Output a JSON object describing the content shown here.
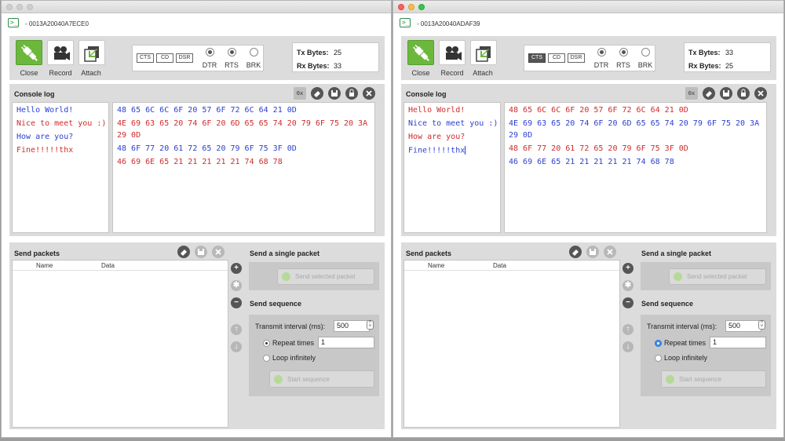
{
  "windows": [
    {
      "mac": "- 0013A20040A7ECE0",
      "toolbar": {
        "close": "Close",
        "record": "Record",
        "attach": "Attach"
      },
      "lines": {
        "cts": "CTS",
        "cd": "CD",
        "dsr": "DSR",
        "dtr": "DTR",
        "rts": "RTS",
        "brk": "BRK"
      },
      "bytes": {
        "tx_label": "Tx Bytes:",
        "tx_value": "25",
        "rx_label": "Rx Bytes:",
        "rx_value": "33"
      },
      "console": {
        "title": "Console log",
        "hex_button": "0x",
        "text_lines": [
          "Hello World!",
          "Nice to meet you :)",
          "How are you?",
          "Fine!!!!!thx"
        ],
        "hex_lines": [
          "48 65 6C 6C 6F 20 57 6F 72 6C 64 21 0D",
          "4E 69 63 65 20 74 6F 20 6D 65 65 74 20 79 6F 75 20 3A",
          "29 0D",
          "48 6F 77 20 61 72 65 20 79 6F 75 3F 0D",
          "46 69 6E 65 21 21 21 21 21 74 68 78"
        ]
      },
      "send": {
        "title": "Send packets",
        "col_name": "Name",
        "col_data": "Data",
        "single_title": "Send a single packet",
        "send_selected": "Send selected packet",
        "seq_title": "Send sequence",
        "interval_label": "Transmit interval (ms):",
        "interval_value": "500",
        "repeat_label": "Repeat times",
        "repeat_value": "1",
        "loop_label": "Loop infinitely",
        "start_label": "Start sequence"
      }
    },
    {
      "mac": "- 0013A20040ADAF39",
      "toolbar": {
        "close": "Close",
        "record": "Record",
        "attach": "Attach"
      },
      "lines": {
        "cts": "CTS",
        "cd": "CD",
        "dsr": "DSR",
        "dtr": "DTR",
        "rts": "RTS",
        "brk": "BRK"
      },
      "bytes": {
        "tx_label": "Tx Bytes:",
        "tx_value": "33",
        "rx_label": "Rx Bytes:",
        "rx_value": "25"
      },
      "console": {
        "title": "Console log",
        "hex_button": "0x",
        "text_lines": [
          "Hello World!",
          "Nice to meet you :)",
          "How are you?",
          "Fine!!!!!thx"
        ],
        "hex_lines": [
          "48 65 6C 6C 6F 20 57 6F 72 6C 64 21 0D",
          "4E 69 63 65 20 74 6F 20 6D 65 65 74 20 79 6F 75 20 3A",
          "29 0D",
          "48 6F 77 20 61 72 65 20 79 6F 75 3F 0D",
          "46 69 6E 65 21 21 21 21 21 74 68 78"
        ]
      },
      "send": {
        "title": "Send packets",
        "col_name": "Name",
        "col_data": "Data",
        "single_title": "Send a single packet",
        "send_selected": "Send selected packet",
        "seq_title": "Send sequence",
        "interval_label": "Transmit interval (ms):",
        "interval_value": "500",
        "repeat_label": "Repeat times",
        "repeat_value": "1",
        "loop_label": "Loop infinitely",
        "start_label": "Start sequence"
      }
    }
  ],
  "colors": {
    "sent": "#2b3fd0",
    "received": "#d02b2b",
    "accent": "#6cb83d"
  }
}
